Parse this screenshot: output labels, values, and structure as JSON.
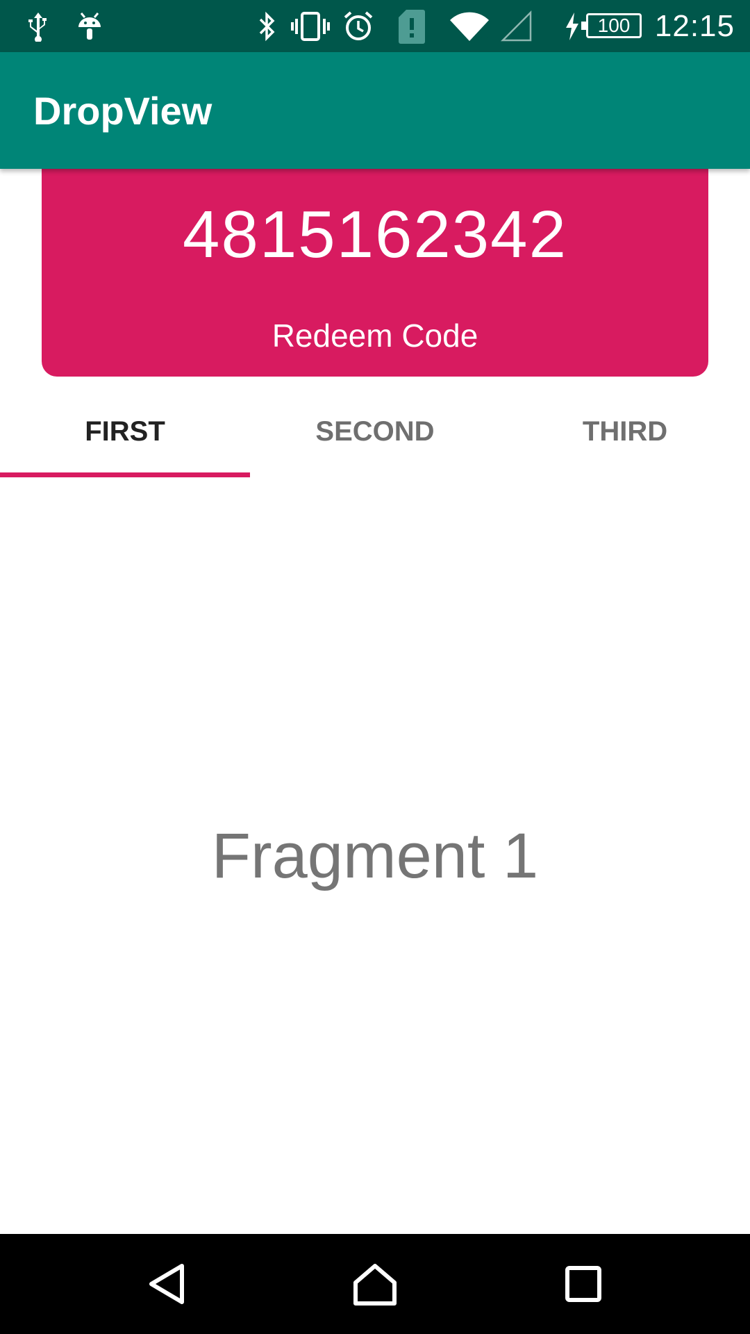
{
  "status_bar": {
    "time": "12:15",
    "battery_level": "100",
    "icons": [
      "usb-icon",
      "android-debug-icon",
      "bluetooth-icon",
      "vibrate-icon",
      "alarm-icon",
      "sim-alert-icon",
      "wifi-icon",
      "cell-signal-icon",
      "charging-icon",
      "battery-icon"
    ]
  },
  "app_bar": {
    "title": "DropView"
  },
  "drop_view": {
    "code": "4815162342",
    "button_label": "Redeem Code",
    "color": "#D81B60"
  },
  "tabs": [
    {
      "label": "FIRST",
      "selected": true
    },
    {
      "label": "SECOND",
      "selected": false
    },
    {
      "label": "THIRD",
      "selected": false
    }
  ],
  "content": {
    "fragment_text": "Fragment 1"
  },
  "nav_bar": {
    "icons": [
      "back-icon",
      "home-icon",
      "recents-icon"
    ]
  },
  "colors": {
    "primary": "#008577",
    "primary_dark": "#00574B",
    "accent": "#D81B60"
  }
}
